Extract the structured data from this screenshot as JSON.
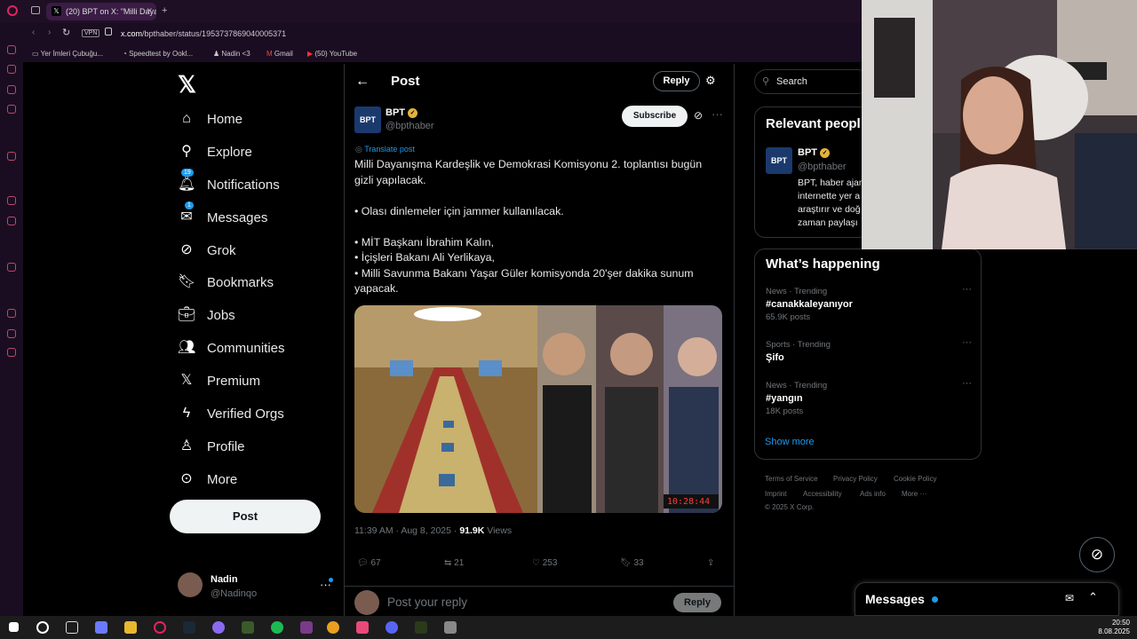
{
  "browser": {
    "tab_title": "(20) BPT on X: \"Milli Daya...",
    "url_prefix": "x.com",
    "url_path": "/bpthaber/status/1953737869040005371",
    "vpn": "VPN",
    "bookmarks": [
      "Yer İmleri Çubuğu...",
      "Speedtest by Ookl...",
      "Nadin <3",
      "Gmail",
      "(50) YouTube"
    ]
  },
  "nav": {
    "items": [
      {
        "label": "Home",
        "icon": "home-icon"
      },
      {
        "label": "Explore",
        "icon": "search-icon"
      },
      {
        "label": "Notifications",
        "icon": "bell-icon",
        "badge": "19"
      },
      {
        "label": "Messages",
        "icon": "mail-icon",
        "badge": "1"
      },
      {
        "label": "Grok",
        "icon": "grok-icon"
      },
      {
        "label": "Bookmarks",
        "icon": "bookmark-icon"
      },
      {
        "label": "Jobs",
        "icon": "briefcase-icon"
      },
      {
        "label": "Communities",
        "icon": "people-icon"
      },
      {
        "label": "Premium",
        "icon": "x-logo-icon"
      },
      {
        "label": "Verified Orgs",
        "icon": "bolt-icon"
      },
      {
        "label": "Profile",
        "icon": "person-icon"
      },
      {
        "label": "More",
        "icon": "more-circle-icon"
      }
    ],
    "post_button": "Post",
    "user": {
      "name": "Nadin",
      "handle": "@Nadinqo"
    }
  },
  "post": {
    "header_title": "Post",
    "reply_top": "Reply",
    "author_name": "BPT",
    "author_handle": "@bpthaber",
    "subscribe": "Subscribe",
    "translate": "Translate post",
    "text": "Milli Dayanışma Kardeşlik ve Demokrasi Komisyonu 2. toplantısı bugün gizli yapılacak.\n\n• Olası dinlemeler için jammer kullanılacak.\n\n• MİT Başkanı İbrahim Kalın,\n• İçişleri Bakanı Ali Yerlikaya,\n• Milli Savunma Bakanı Yaşar Güler komisyonda 20'şer dakika sunum yapacak.",
    "media_timestamp": "10:28:44",
    "time": "11:39 AM · Aug 8, 2025 · ",
    "views_count": "91.9K",
    "views_label": " Views",
    "stats": {
      "replies": "67",
      "reposts": "21",
      "likes": "253",
      "bookmarks": "33"
    },
    "reply_placeholder": "Post your reply",
    "reply_button": "Reply"
  },
  "right": {
    "search_placeholder": "Search",
    "relevant_title": "Relevant peopl",
    "relevant": {
      "name": "BPT",
      "handle": "@bpthaber",
      "bio": "BPT, haber ajan internette yer a araştırır ve doğ zaman paylaşı"
    },
    "happening_title": "What’s happening",
    "trends": [
      {
        "category": "News · Trending",
        "title": "#canakkaleyanıyor",
        "count": "65.9K posts"
      },
      {
        "category": "Sports · Trending",
        "title": "Şifo",
        "count": ""
      },
      {
        "category": "News · Trending",
        "title": "#yangın",
        "count": "18K posts"
      }
    ],
    "show_more": "Show more",
    "footer": [
      "Terms of Service",
      "Privacy Policy",
      "Cookie Policy",
      "Imprint",
      "Accessibility",
      "Ads info",
      "More ···",
      "© 2025 X Corp."
    ]
  },
  "messages_drawer": {
    "title": "Messages"
  },
  "taskbar": {
    "time": "20:50",
    "date": "8.08.2025"
  },
  "colors": {
    "accent": "#1d9bf0",
    "bg": "#000000",
    "browser": "#1b0d21"
  }
}
